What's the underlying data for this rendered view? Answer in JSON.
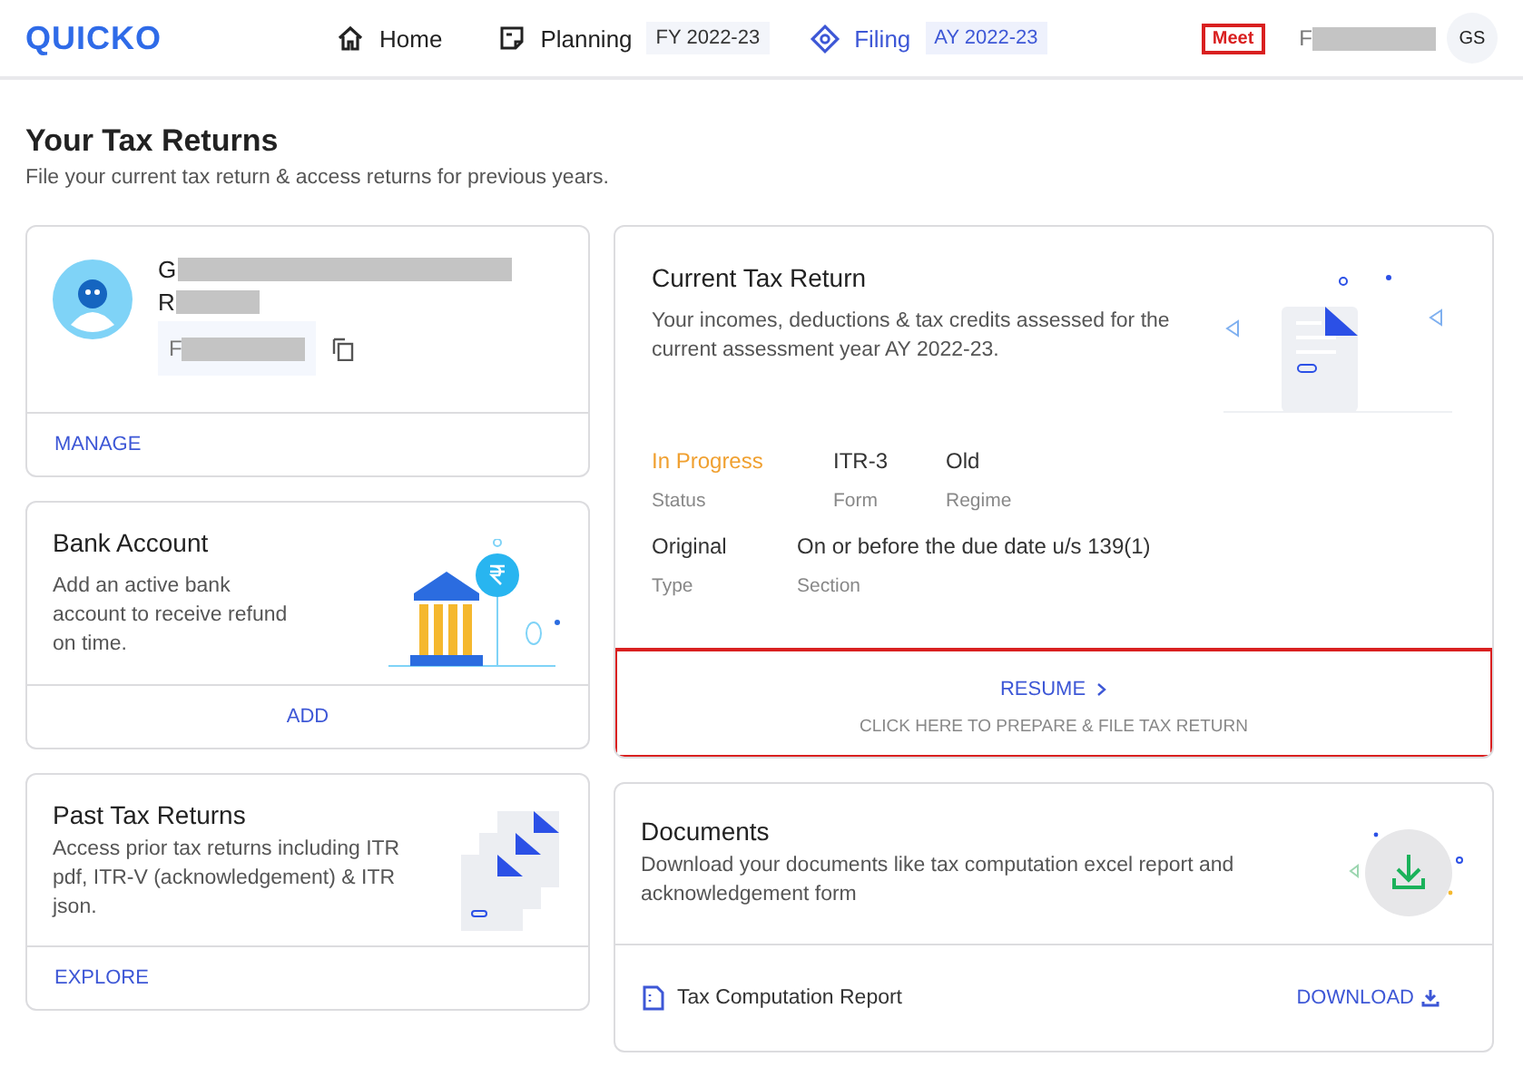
{
  "header": {
    "logo": "QUICKO",
    "nav": [
      {
        "label": "Home",
        "selected": false
      },
      {
        "label": "Planning",
        "badge": "FY 2022-23",
        "selected": false
      },
      {
        "label": "Filing",
        "badge": "AY 2022-23",
        "selected": true
      }
    ],
    "meet": "Meet",
    "user_initial": "F",
    "avatar": "GS"
  },
  "page": {
    "title": "Your Tax Returns",
    "subtitle": "File your current tax return & access returns for previous years."
  },
  "profile": {
    "name_initial": "G",
    "second_initial": "R",
    "id_initial": "F",
    "action": "MANAGE"
  },
  "bank": {
    "title": "Bank Account",
    "description": "Add an active bank account to receive refund on time.",
    "action": "ADD"
  },
  "past": {
    "title": "Past Tax Returns",
    "description": "Access prior tax returns including ITR pdf, ITR-V (acknowledgement) & ITR json.",
    "action": "EXPLORE"
  },
  "current": {
    "title": "Current Tax Return",
    "description": "Your incomes, deductions & tax credits assessed for the current assessment year AY 2022-23.",
    "rows": [
      [
        {
          "value": "In Progress",
          "label": "Status",
          "kind": "status"
        },
        {
          "value": "ITR-3",
          "label": "Form",
          "kind": "plain"
        },
        {
          "value": "Old",
          "label": "Regime",
          "kind": "plain"
        }
      ],
      [
        {
          "value": "Original",
          "label": "Type",
          "kind": "plain"
        },
        {
          "value": "On or before the due date u/s 139(1)",
          "label": "Section",
          "kind": "plain"
        }
      ]
    ],
    "action": "RESUME",
    "hint": "CLICK HERE TO PREPARE & FILE TAX RETURN",
    "highlighted": true
  },
  "documents": {
    "title": "Documents",
    "description": "Download your documents like tax computation excel report and acknowledgement form",
    "items": [
      {
        "name": "Tax Computation Report",
        "action": "DOWNLOAD"
      }
    ]
  }
}
